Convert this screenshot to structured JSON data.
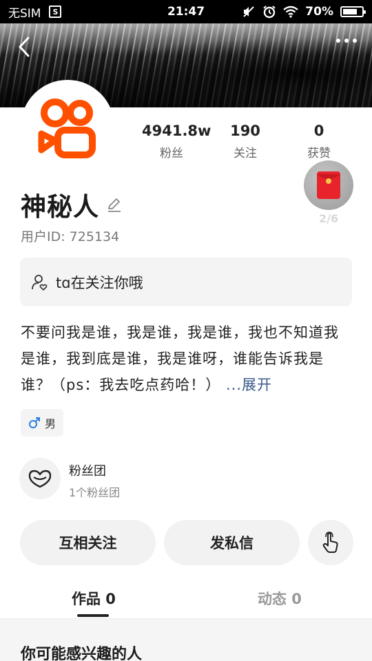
{
  "status_bar": {
    "carrier": "无SIM",
    "sim_icon_text": "S",
    "time": "21:47",
    "battery": "70%",
    "battery_level": 0.7
  },
  "header": {
    "back_icon": "chevron-left-icon",
    "more_icon": "more-dots-icon"
  },
  "profile": {
    "name": "神秘人",
    "user_id": "用户ID: 725134",
    "stats": [
      {
        "value": "4941.8w",
        "label": "粉丝"
      },
      {
        "value": "190",
        "label": "关注"
      },
      {
        "value": "0",
        "label": "获赞"
      }
    ],
    "redpacket_count": "2/6",
    "follow_notice": "tɑ在关注你哦",
    "bio": "不要问我是谁，我是谁，我是谁，我也不知道我是谁，我到底是谁，我是谁呀，谁能告诉我是谁？（ps：我去吃点药哈！）",
    "bio_expand": "...展开",
    "gender": "男",
    "gender_icon": "male-icon"
  },
  "fan_club": {
    "title": "粉丝团",
    "subtitle": "1个粉丝团"
  },
  "actions": {
    "follow_back": "互相关注",
    "message": "发私信"
  },
  "tabs": [
    {
      "label": "作品 0",
      "active": true
    },
    {
      "label": "动态 0",
      "active": false
    }
  ],
  "recommend": {
    "title": "你可能感兴趣的人"
  },
  "colors": {
    "brand_orange": "#ff5000",
    "link_blue": "#3a5a8a",
    "redpacket_red": "#e8232b"
  }
}
